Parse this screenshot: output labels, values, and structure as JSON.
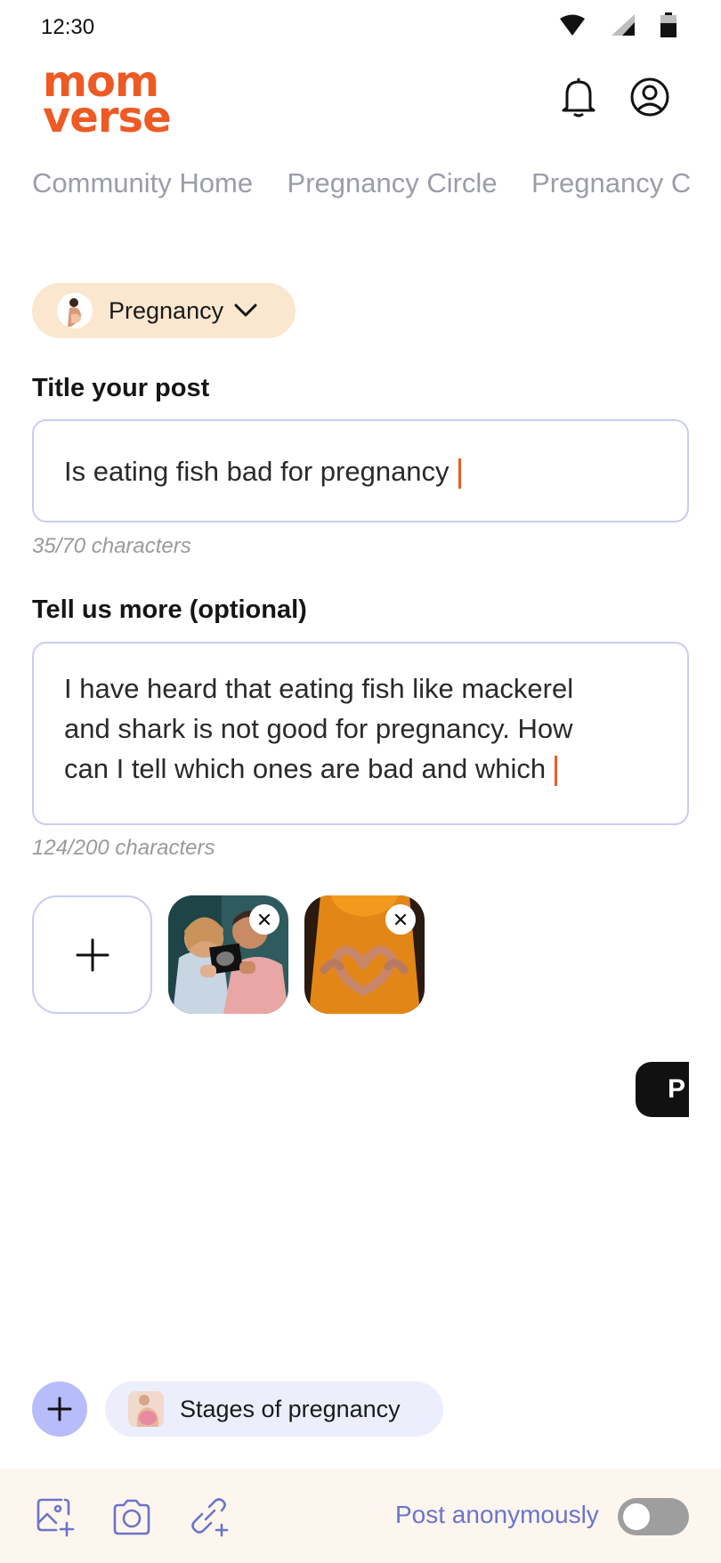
{
  "status_bar": {
    "time": "12:30",
    "icons": [
      "wifi-icon",
      "signal-icon",
      "battery-icon"
    ]
  },
  "header": {
    "logo_top": "mom",
    "logo_bottom": "verse",
    "icons": [
      "bell-icon",
      "profile-icon"
    ]
  },
  "tabs": [
    {
      "label": "Community Home"
    },
    {
      "label": "Pregnancy Circle"
    },
    {
      "label": "Pregnancy C"
    }
  ],
  "category": {
    "label": "Pregnancy",
    "icon": "chevron-down-icon"
  },
  "title_section": {
    "label": "Title your post",
    "value": "Is eating fish bad for pregnancy",
    "count": "35/70 characters"
  },
  "body_section": {
    "label": "Tell us more (optional)",
    "lines": [
      "I have heard that eating fish like mackerel",
      "and shark is not good for pregnancy. How",
      "can I tell which ones are bad and which"
    ],
    "count": "124/200 characters"
  },
  "media": {
    "add_icon": "plus-icon",
    "thumbnails": [
      {
        "subject": "couple-ultrasound-photo"
      },
      {
        "subject": "hands-heart-on-belly-photo"
      }
    ],
    "remove_icon": "close-icon"
  },
  "post_button": {
    "label": "P"
  },
  "topic": {
    "add_icon": "plus-icon",
    "label": "Stages of pregnancy"
  },
  "toolbar": {
    "icons": [
      "add-image-icon",
      "camera-icon",
      "attach-link-icon"
    ],
    "anonymous_label": "Post anonymously",
    "anonymous_enabled": false
  },
  "colors": {
    "brand": "#ee5a24",
    "accent": "#6b74c9",
    "field_border": "#c9cdf3",
    "pill_bg": "#fbe6cf",
    "chip_bg": "#eceefc",
    "toolbar_bg": "#fdf6ef"
  }
}
